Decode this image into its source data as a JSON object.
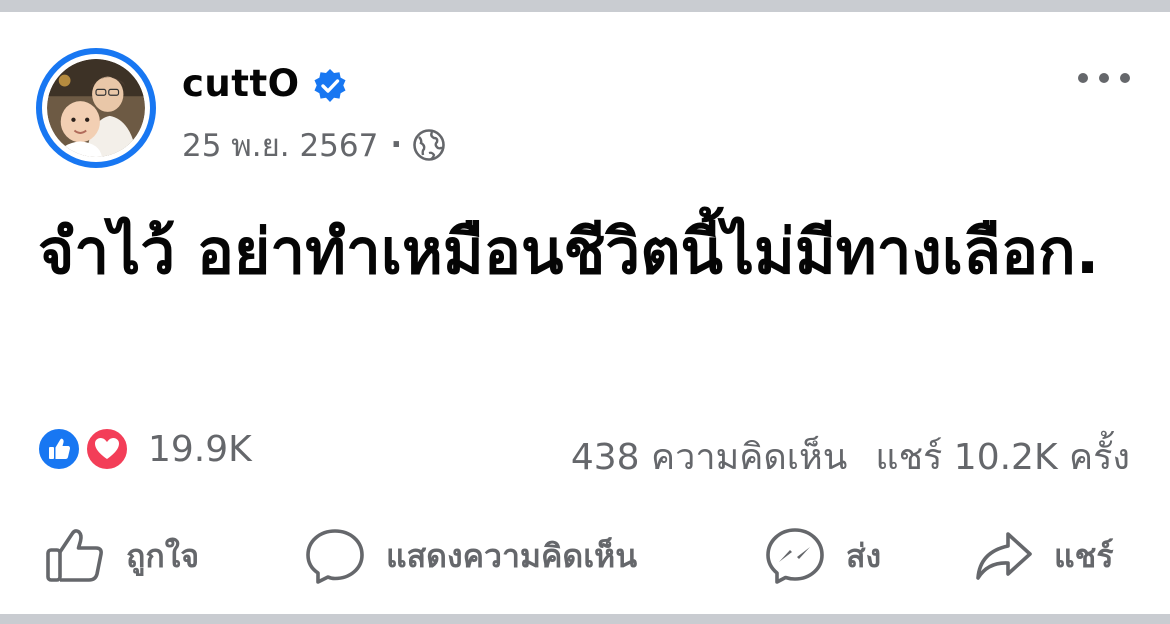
{
  "post": {
    "author": "cuttO",
    "date": "25 พ.ย. 2567",
    "separator": "·",
    "text": "จำไว้ อย่าทำเหมือนชีวิตนี้ไม่มีทางเลือก."
  },
  "stats": {
    "reaction_count": "19.9K",
    "comments": "438 ความคิดเห็น",
    "shares": "แชร์ 10.2K ครั้ง"
  },
  "actions": {
    "like": "ถูกใจ",
    "comment": "แสดงความคิดเห็น",
    "send": "ส่ง",
    "share": "แชร์"
  },
  "icons": {
    "verified": "verified-badge-icon",
    "privacy": "globe-icon",
    "more": "more-options-icon",
    "reaction_like": "like-reaction-icon",
    "reaction_love": "love-reaction-icon",
    "action_like": "thumbs-up-icon",
    "action_comment": "comment-bubble-icon",
    "action_send": "messenger-icon",
    "action_share": "share-arrow-icon"
  },
  "colors": {
    "accent": "#1877f2",
    "love": "#f33e58",
    "text": "#050505",
    "secondary_text": "#65676b",
    "divider": "#c9ccd1"
  }
}
